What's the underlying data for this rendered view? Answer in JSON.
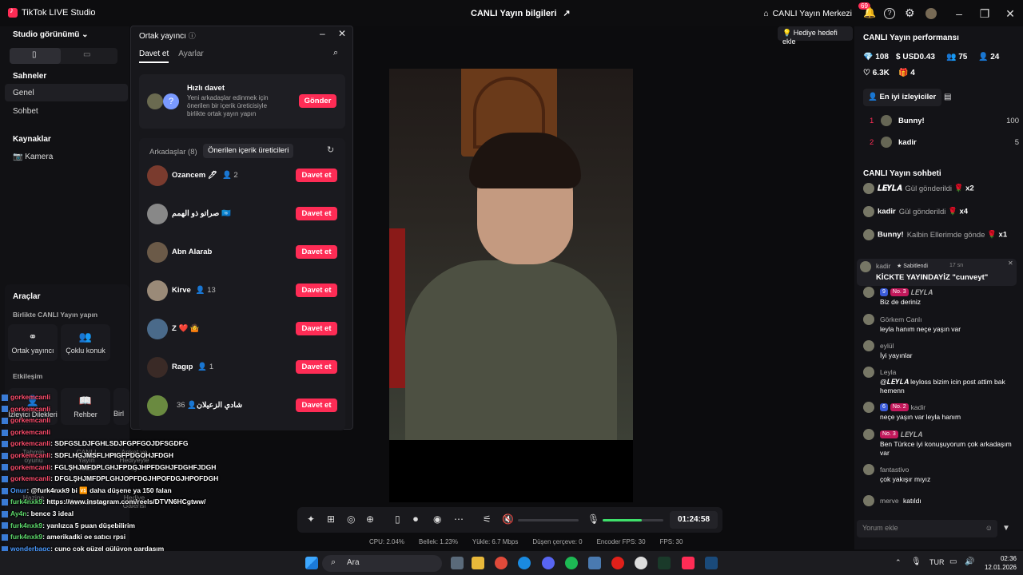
{
  "app": {
    "title": "TikTok LIVE Studio",
    "center_title": "CANLI Yayın bilgileri",
    "live_center": "CANLI Yayın Merkezi",
    "notif_count": "69"
  },
  "left": {
    "studio_view": "Studio görünümü",
    "scenes_title": "Sahneler",
    "scenes": [
      "Genel",
      "Sohbet"
    ],
    "sources_title": "Kaynaklar",
    "sources": [
      "Kamera"
    ],
    "tools_title": "Araçlar",
    "together_title": "Birlikte CANLI Yayın yapın",
    "tools": [
      "Ortak yayıncı",
      "Çoklu konuk"
    ],
    "interaction_title": "Etkileşim",
    "interaction_tools": [
      "İzleyici Dilekleri",
      "Rehber",
      "Birl"
    ]
  },
  "overlay_chat": [
    {
      "user": "gorkemcanli",
      "text": ""
    },
    {
      "user": "gorkemcanli",
      "text": ""
    },
    {
      "user": "gorkemcanli",
      "text": ""
    },
    {
      "user": "gorkemcanli",
      "text": ""
    },
    {
      "user": "gorkemcanli",
      "text": ": SDFGSLDJFGHLSDJFGPFGOJDFSGDFG"
    },
    {
      "user": "gorkemcanli",
      "text": ": SDFLHGJMSFLHPIGFPDGOHJFDGH"
    },
    {
      "user": "gorkemcanli",
      "text": ": FGLŞHJMFDPLGHJFPDGJHPFDGHJFDGHFJDGH"
    },
    {
      "user": "gorkemcanli",
      "text": ": DFGLŞHJMFDPLGHJOPFDGJHPOFDGJHPOFDGH"
    },
    {
      "user": "Onur",
      "text": ": @furk4nxk9 bi 🆚 daha düşene ya 150 falan"
    },
    {
      "user": "furk4nxk9",
      "text": ": https://www.instagram.com/reels/DTVN6HCgtww/"
    },
    {
      "user": "Ay4n",
      "text": ": bence 3 ideal"
    },
    {
      "user": "furk4nxk9",
      "text": ": yanlızca 5 puan düşebilirim"
    },
    {
      "user": "furk4nxk9",
      "text": ": amerikadki oe satıcı rpsi"
    },
    {
      "user": "wonderbagc",
      "text": ": cuno çok güzel gülüyon gardaşım"
    },
    {
      "user": "Onur",
      "text": ": ölüm 500ken attım bitti ya"
    }
  ],
  "overlay_ghost_labels": [
    "Tahmin oyunu",
    "CANLI Yayın Hedefi",
    "Anket ve Hediyeyle oy",
    "Hazine",
    "Özel Görev",
    "Hediye Galerisi"
  ],
  "modal": {
    "title": "Ortak yayıncı",
    "tabs": [
      "Davet et",
      "Ayarlar"
    ],
    "quick_title": "Hızlı davet",
    "quick_desc": "Yeni arkadaşlar edinmek için önerilen bir içerik üreticisiyle birlikte ortak yayın yapın",
    "send": "Gönder",
    "friends_tab": "Arkadaşlar (8)",
    "suggested_tab": "Önerilen içerik üreticileri",
    "invite_label": "Davet et",
    "friends": [
      {
        "name": "Ozancem 🖊",
        "count": "2",
        "color": "#7a3b2e"
      },
      {
        "name": "صراتو ذو الهمم 🇺🇳",
        "count": "",
        "color": "#888888"
      },
      {
        "name": "Abn Alarab",
        "count": "",
        "color": "#6b5a48"
      },
      {
        "name": "Kirve",
        "count": "13",
        "color": "#9a8a78"
      },
      {
        "name": "Z ❤️ 🤷",
        "count": "",
        "color": "#4a6a8a"
      },
      {
        "name": "Ragıp",
        "count": "1",
        "color": "#3a2a26"
      },
      {
        "name": "شادي الزعيلان",
        "count": "36",
        "color": "#6a8a40"
      }
    ]
  },
  "controls": {
    "timer": "01:24:58",
    "volume_pct": 65
  },
  "stats": [
    "CPU: 2.04%",
    "Bellek: 1.23%",
    "Yükle: 6.7 Mbps",
    "Düşen çerçeve: 0",
    "Encoder FPS: 30",
    "FPS: 30"
  ],
  "gift_goal": "Hediye hedefi ekle",
  "right": {
    "perf_title": "CANLI Yayın performansı",
    "metrics": [
      "108",
      "USD0.43",
      "75",
      "24",
      "6.3K",
      "4"
    ],
    "top_viewers_btn": "En iyi izleyiciler",
    "leaderboard": [
      {
        "rank": "1",
        "name": "Bunny!",
        "score": "100"
      },
      {
        "rank": "2",
        "name": "kadir",
        "score": "5"
      }
    ],
    "chat_title": "CANLI Yayın sohbeti",
    "gifts": [
      {
        "user": "𝑳𝑬𝒀𝑳𝑨",
        "text": "Gül gönderildi",
        "mult": "x2"
      },
      {
        "user": "kadir",
        "text": "Gül gönderildi",
        "mult": "x4"
      },
      {
        "user": "Bunny!",
        "text": "Kalbin Ellerimde göndе",
        "mult": "x1"
      }
    ],
    "pinned": {
      "user": "kadir",
      "tag": "Sabitlendi",
      "time": "17 sn",
      "text": "KİCKTE YAYINDAYİZ \"cunveyt\""
    },
    "messages": [
      {
        "user": "𝑳𝑬𝒀𝑳𝑨",
        "badges": [
          "9",
          "No. 3"
        ],
        "text": "Biz de deriniz"
      },
      {
        "user": "Görkem Canlı",
        "badges": [],
        "text": "leyla hanım neçe yaşın var"
      },
      {
        "user": "eylül",
        "badges": [],
        "text": "İyi yayınlar"
      },
      {
        "user": "Leyla",
        "badges": [],
        "text": "@𝑳𝑬𝒀𝑳𝑨 leyloss bizim icin post attim bak hemenn"
      },
      {
        "user": "kadir",
        "badges": [
          "6",
          "No. 2"
        ],
        "text": "neçe yaşın var leyla hanım"
      },
      {
        "user": "𝑳𝑬𝒀𝑳𝑨",
        "badges": [
          "No. 3"
        ],
        "text": "Ben Türkce iyi konuşuyorum çok arkadaşım var"
      },
      {
        "user": "fantastivo",
        "badges": [],
        "text": "çok yakışır mıyız"
      },
      {
        "user": "merve",
        "badges": [],
        "text": "katıldı"
      }
    ],
    "comment_placeholder": "Yorum ekle"
  },
  "taskbar": {
    "search": "Ara",
    "lang": "TUR",
    "time": "02:36",
    "date": "12.01.2026"
  }
}
